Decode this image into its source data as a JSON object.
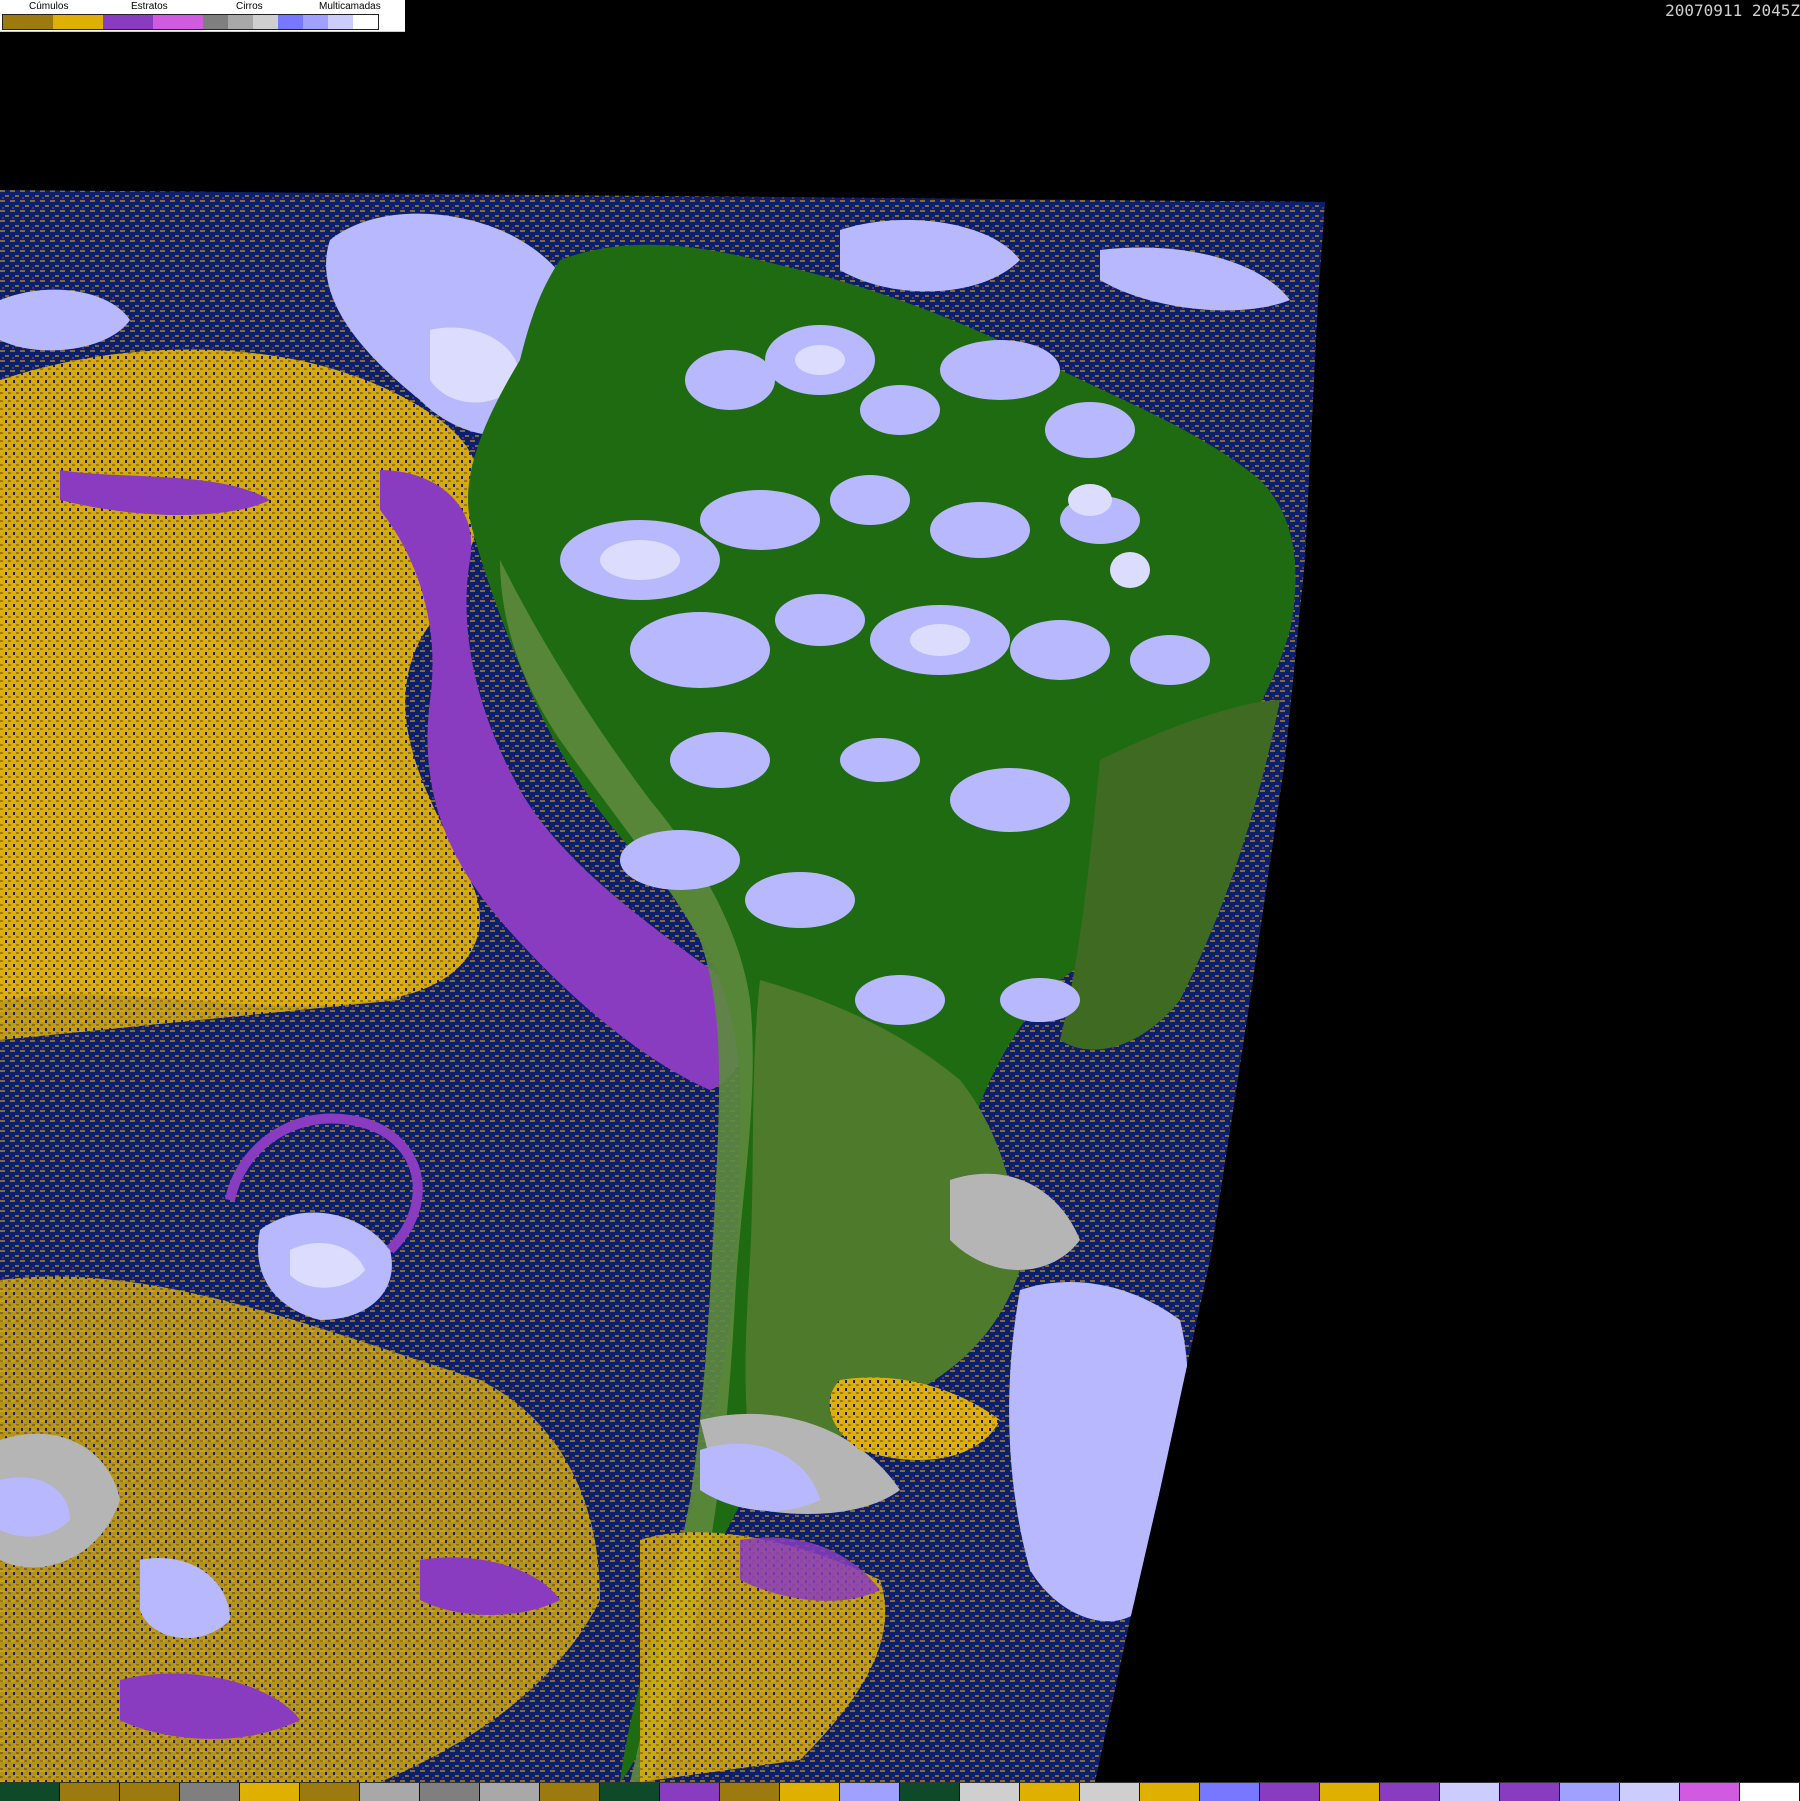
{
  "legend": {
    "labels": [
      "Cúmulos",
      "Estratos",
      "Cirros",
      "Multicamadas"
    ],
    "swatch_colors": [
      "#9c7a10",
      "#e0b000",
      "#8a3cc0",
      "#d05ae0",
      "#7f7f7f",
      "#a8a8a8",
      "#cfcfcf",
      "#7777ff",
      "#a0a0ff",
      "#ccccff",
      "#ffffff"
    ]
  },
  "timestamp": "20070911 2045Z",
  "colors": {
    "background": "#000000",
    "ocean": "#0b1f6e",
    "land_forest": "#1f6b12",
    "land_grass": "#4e7a2c",
    "cumulus_low": "#e0b000",
    "cumulus_dark": "#9c7a10",
    "stratus": "#8a3cc0",
    "stratus_light": "#d05ae0",
    "cirrus": "#b5b5b5",
    "multilayer": "#b8b8ff",
    "multilayer_light": "#dcdcff"
  },
  "bottom_scale": [
    "#0e4a2a",
    "#9c7a10",
    "#9c7a10",
    "#7f7f7f",
    "#e0b000",
    "#9c7a10",
    "#a8a8a8",
    "#7f7f7f",
    "#a8a8a8",
    "#9c7a10",
    "#0e4a2a",
    "#8a3cc0",
    "#9c7a10",
    "#e0b000",
    "#a0a0ff",
    "#0e4a2a",
    "#cfcfcf",
    "#e0b000",
    "#cfcfcf",
    "#e0b000",
    "#7777ff",
    "#8a3cc0",
    "#e0b000",
    "#8a3cc0",
    "#ccccff",
    "#8a3cc0",
    "#a0a0ff",
    "#ccccff",
    "#d05ae0",
    "#ffffff"
  ]
}
